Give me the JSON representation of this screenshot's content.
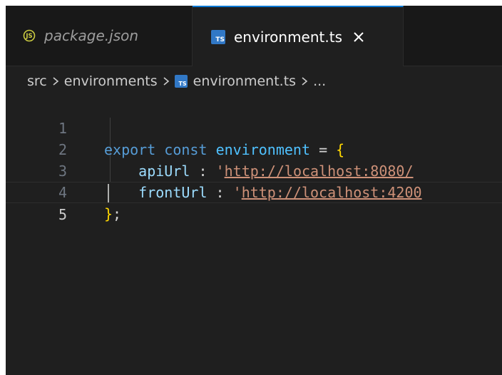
{
  "tabs": [
    {
      "label": "package.json",
      "icon": "json-icon",
      "active": false
    },
    {
      "label": "environment.ts",
      "icon": "typescript-icon",
      "active": true
    }
  ],
  "breadcrumb": {
    "items": [
      "src",
      "environments",
      "environment.ts",
      "..."
    ]
  },
  "editor": {
    "lines": [
      {
        "number": "1",
        "tokens": [
          "export",
          "const",
          "environment",
          "=",
          "{"
        ]
      },
      {
        "number": "2",
        "tokens": [
          "apiUrl",
          ":",
          "'",
          "http://localhost:8080/"
        ]
      },
      {
        "number": "3",
        "tokens": [
          "frontUrl",
          ":",
          "'",
          "http://localhost:4200"
        ]
      },
      {
        "number": "4",
        "tokens": [
          "}",
          ";"
        ]
      },
      {
        "number": "5",
        "tokens": []
      }
    ],
    "current_line": 5
  },
  "colors": {
    "accent": "#0078d4",
    "keyword": "#569cd6",
    "variable": "#4fc1ff",
    "property": "#9cdcfe",
    "string": "#ce9178",
    "brace": "#ffd700",
    "typescript_icon": "#3178c6",
    "json_icon": "#cbcb41"
  }
}
